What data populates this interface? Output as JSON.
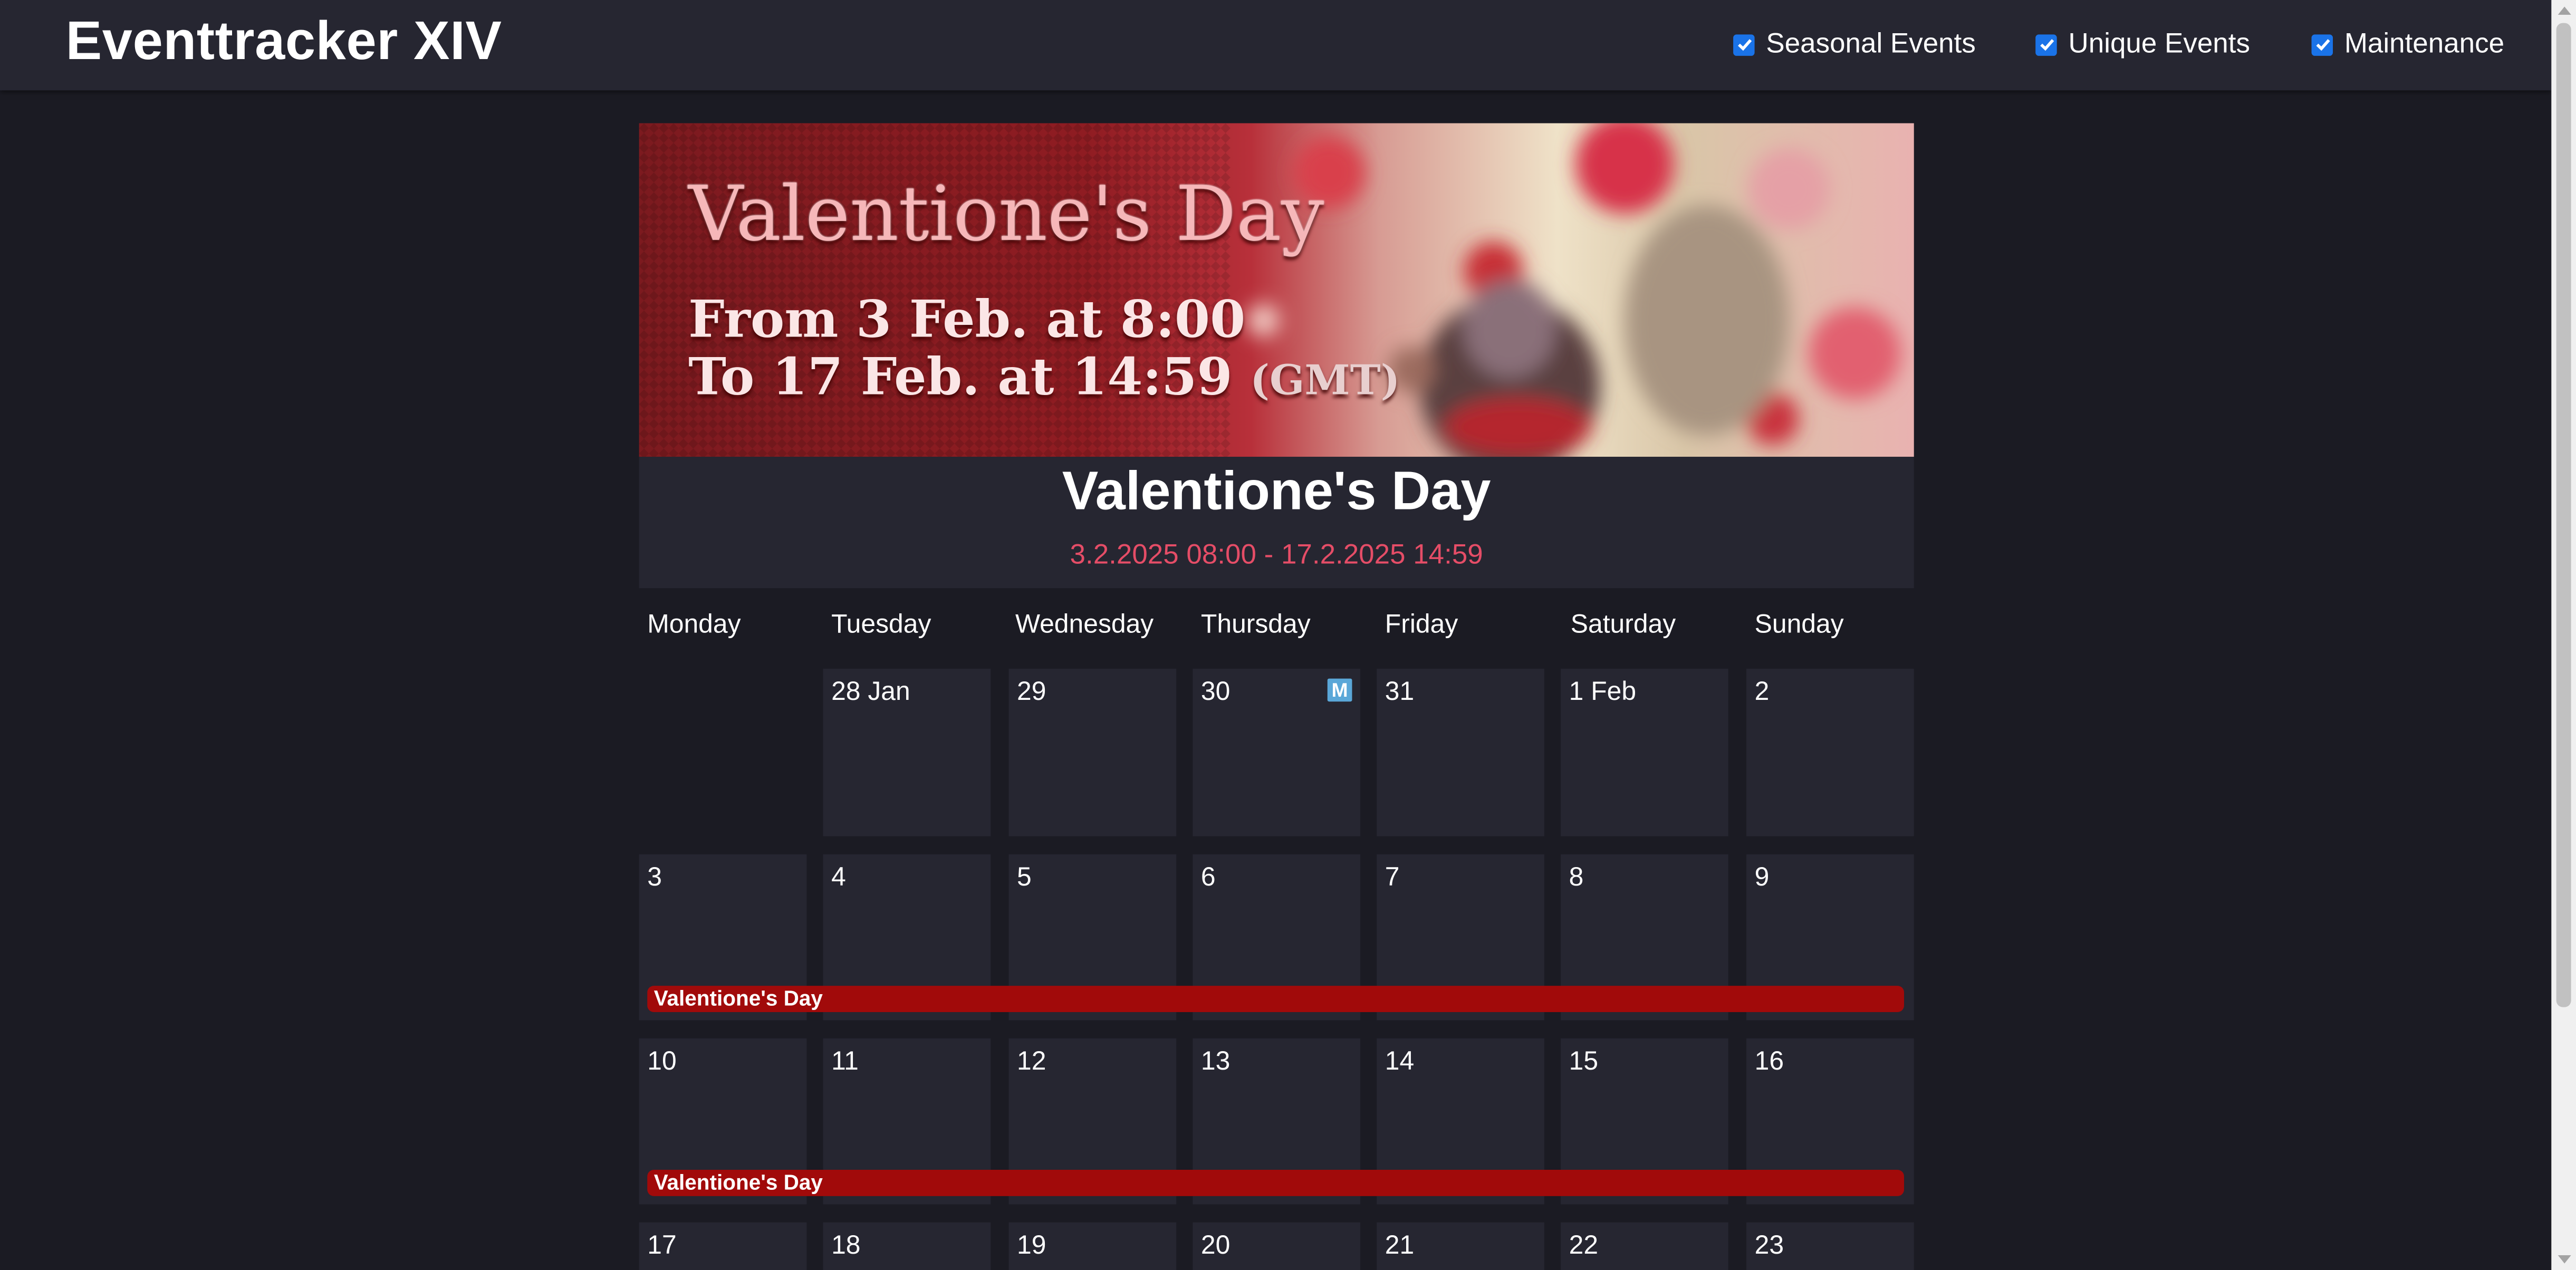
{
  "app": {
    "title": "Eventtracker XIV"
  },
  "filters": [
    {
      "label": "Seasonal Events",
      "checked": true
    },
    {
      "label": "Unique Events",
      "checked": true
    },
    {
      "label": "Maintenance",
      "checked": true
    }
  ],
  "event": {
    "banner": {
      "title": "Valentione's Day",
      "line1": "From 3 Feb. at 8:00",
      "line2": "To 17 Feb. at 14:59",
      "line2_suffix": "(GMT)"
    },
    "name": "Valentione's Day",
    "dates": "3.2.2025 08:00 - 17.2.2025 14:59",
    "color": "#a10a0a",
    "date_color": "#e54d67"
  },
  "calendar": {
    "weekdays": [
      "Monday",
      "Tuesday",
      "Wednesday",
      "Thursday",
      "Friday",
      "Saturday",
      "Sunday"
    ],
    "weeks": [
      [
        null,
        "28 Jan",
        "29",
        "30",
        "31",
        "1 Feb",
        "2"
      ],
      [
        "3",
        "4",
        "5",
        "6",
        "7",
        "8",
        "9"
      ],
      [
        "10",
        "11",
        "12",
        "13",
        "14",
        "15",
        "16"
      ],
      [
        "17",
        "18",
        "19",
        "20",
        "21",
        "22",
        "23"
      ]
    ],
    "maintenance": {
      "week": 0,
      "day": 3,
      "label": "M"
    },
    "event_bars": [
      {
        "week": 1,
        "label": "Valentione's Day"
      },
      {
        "week": 2,
        "label": "Valentione's Day"
      }
    ]
  }
}
